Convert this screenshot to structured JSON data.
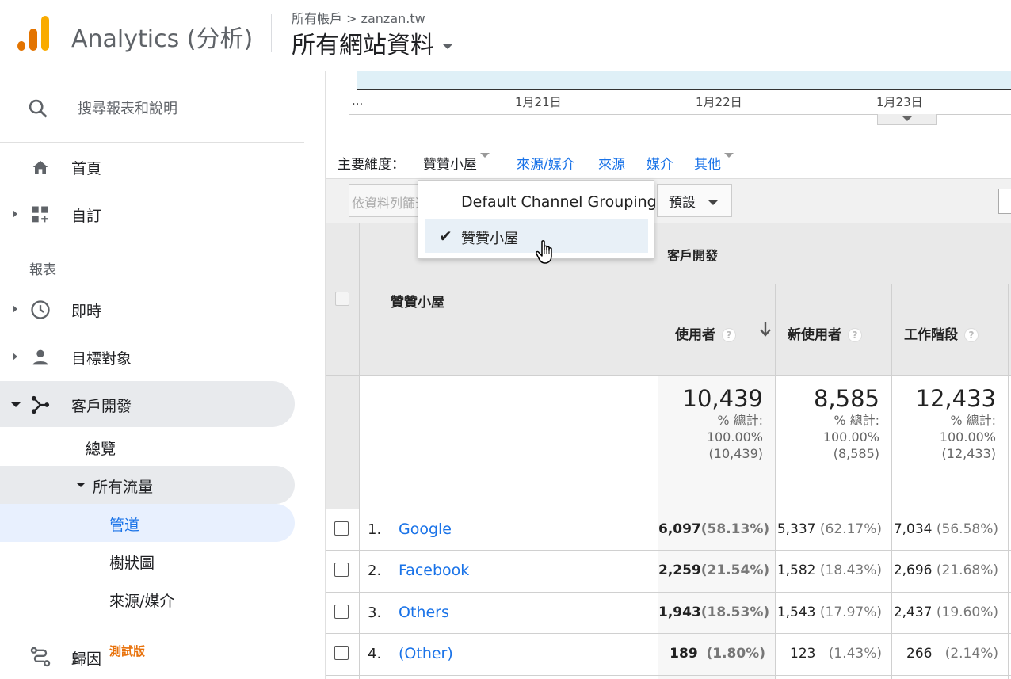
{
  "header": {
    "app_name": "Analytics (分析)",
    "breadcrumb": "所有帳戶 > zanzan.tw",
    "property_view": "所有網站資料"
  },
  "sidebar": {
    "search_placeholder": "搜尋報表和說明",
    "home": "首頁",
    "customize": "自訂",
    "reports_section": "報表",
    "realtime": "即時",
    "audience": "目標對象",
    "acquisition": "客戶開發",
    "overview": "總覽",
    "all_traffic": "所有流量",
    "channels": "管道",
    "treemaps": "樹狀圖",
    "source_medium": "來源/媒介",
    "attribution": "歸因",
    "beta_badge": "測試版"
  },
  "timeline": {
    "ellipsis": "...",
    "dates": [
      "1月21日",
      "1月22日",
      "1月23日"
    ]
  },
  "dimension_bar": {
    "label": "主要維度：",
    "current": "贊贊小屋",
    "options": [
      "來源/媒介",
      "來源",
      "媒介",
      "其他"
    ]
  },
  "filter": {
    "placeholder": "依資料列篩選",
    "preset": "預設"
  },
  "dropdown": {
    "items": [
      "Default Channel Grouping",
      "贊贊小屋"
    ],
    "selected_index": 1
  },
  "table": {
    "dimension_header": "贊贊小屋",
    "group_header": "客戶開發",
    "columns": [
      "使用者",
      "新使用者",
      "工作階段"
    ],
    "totals": [
      {
        "value": "10,439",
        "label": "% 總計:",
        "pct": "100.00%",
        "abs": "(10,439)"
      },
      {
        "value": "8,585",
        "label": "% 總計:",
        "pct": "100.00%",
        "abs": "(8,585)"
      },
      {
        "value": "12,433",
        "label": "% 總計:",
        "pct": "100.00%",
        "abs": "(12,433)"
      }
    ],
    "rows": [
      {
        "num": "1.",
        "name": "Google",
        "users": "6,097",
        "users_pct": "(58.13%)",
        "new_users": "5,337",
        "new_users_pct": "(62.17%)",
        "sessions": "7,034",
        "sessions_pct": "(56.58%)"
      },
      {
        "num": "2.",
        "name": "Facebook",
        "users": "2,259",
        "users_pct": "(21.54%)",
        "new_users": "1,582",
        "new_users_pct": "(18.43%)",
        "sessions": "2,696",
        "sessions_pct": "(21.68%)"
      },
      {
        "num": "3.",
        "name": "Others",
        "users": "1,943",
        "users_pct": "(18.53%)",
        "new_users": "1,543",
        "new_users_pct": "(17.97%)",
        "sessions": "2,437",
        "sessions_pct": "(19.60%)"
      },
      {
        "num": "4.",
        "name": "(Other)",
        "users": "189",
        "users_pct": "(1.80%)",
        "new_users": "123",
        "new_users_pct": "(1.43%)",
        "sessions": "266",
        "sessions_pct": "(2.14%)"
      }
    ]
  },
  "colors": {
    "accent": "#1a73e8",
    "logo_orange": "#e37400",
    "logo_yellow": "#f9ab00",
    "beta": "#e8710a"
  }
}
